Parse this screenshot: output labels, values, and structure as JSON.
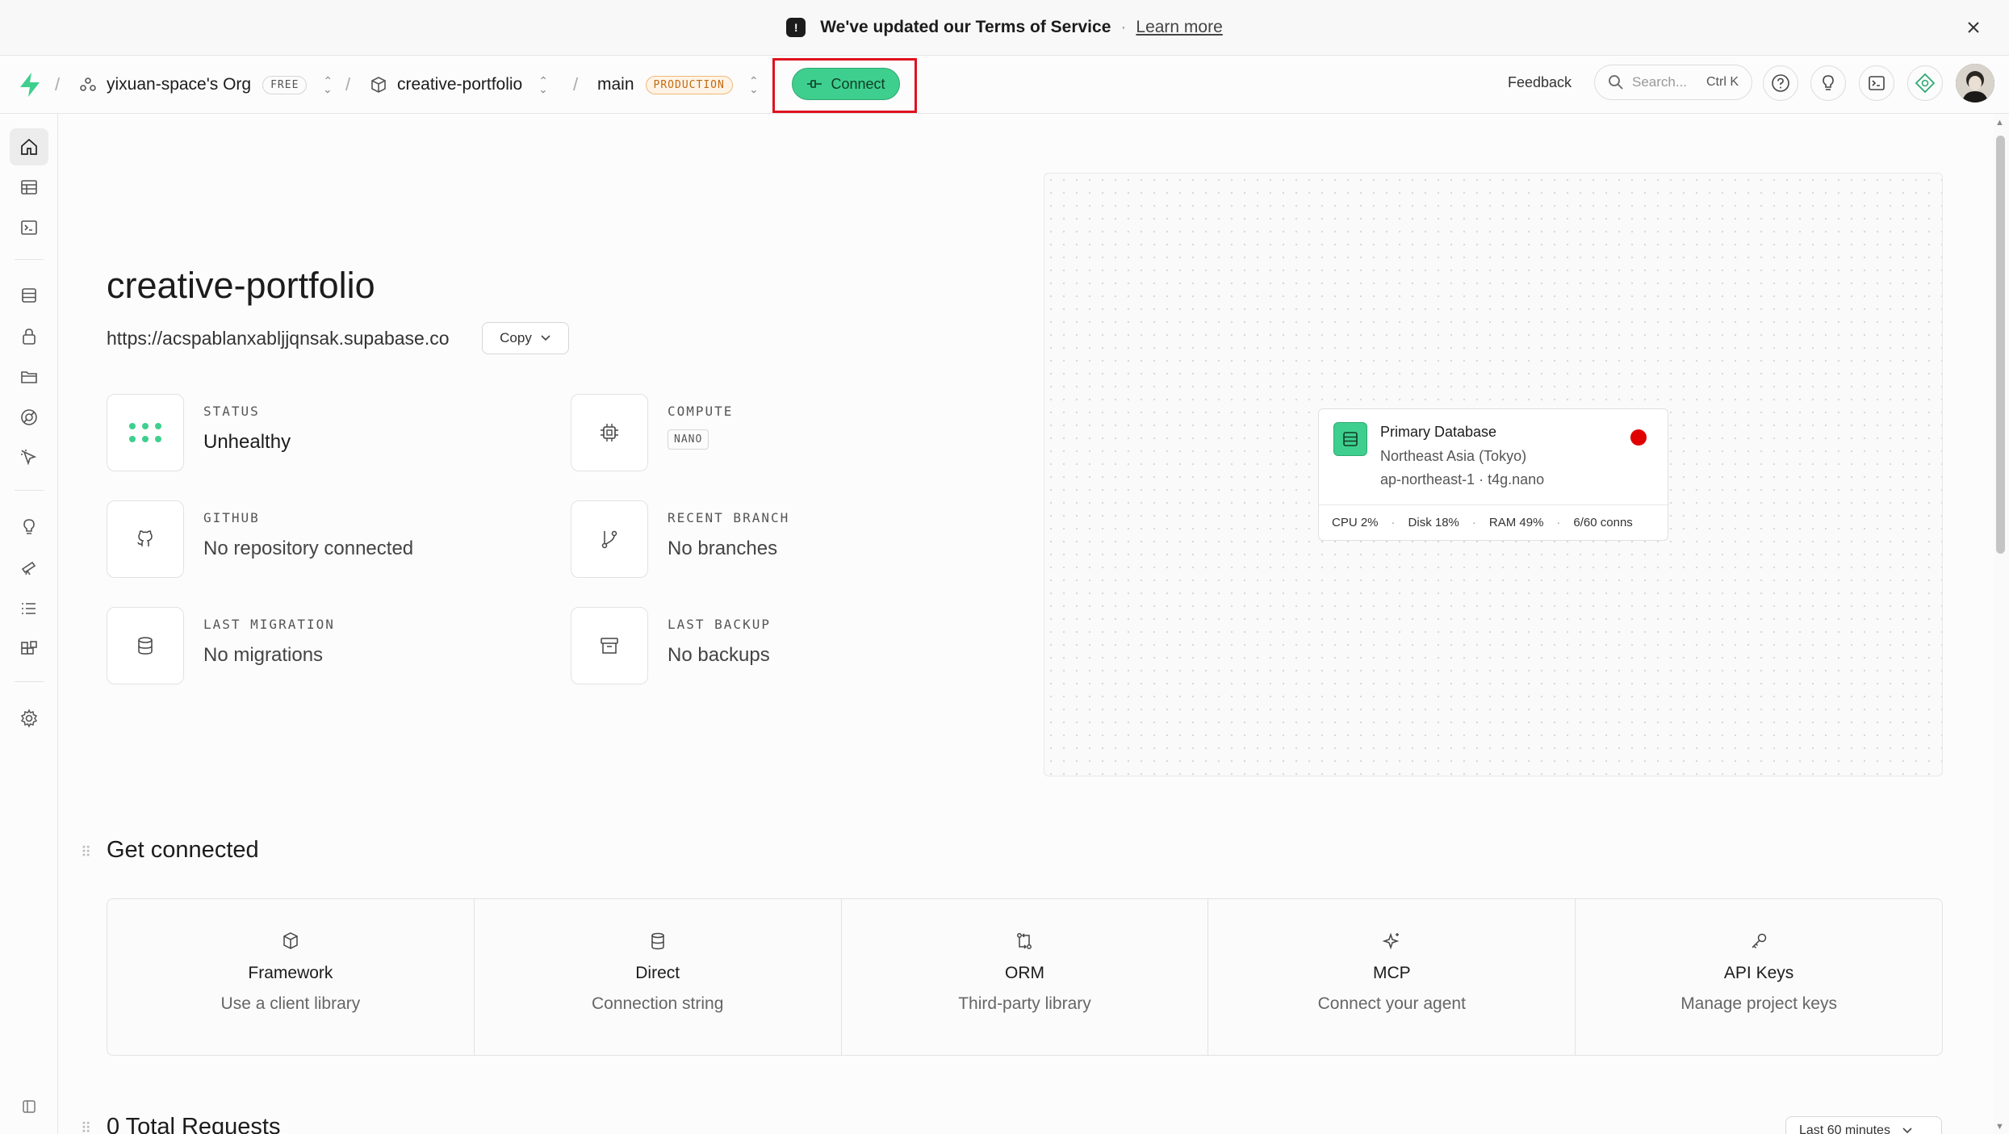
{
  "banner": {
    "text": "We've updated our Terms of Service",
    "separator": "·",
    "link": "Learn more"
  },
  "nav": {
    "org": "yixuan-space's Org",
    "org_plan": "FREE",
    "project": "creative-portfolio",
    "branch": "main",
    "branch_env": "PRODUCTION",
    "connect_label": "Connect",
    "feedback_label": "Feedback",
    "search_placeholder": "Search...",
    "search_shortcut": "Ctrl K"
  },
  "sidebar": {
    "items": [
      "home-icon",
      "table-editor-icon",
      "sql-editor-icon",
      "database-icon",
      "auth-icon",
      "storage-icon",
      "realtime-icon",
      "edge-functions-icon",
      "advisors-icon",
      "reports-icon",
      "logs-icon",
      "integrations-icon",
      "settings-icon"
    ],
    "active": "home-icon"
  },
  "project": {
    "title": "creative-portfolio",
    "url": "https://acspablanxabljjqnsak.supabase.co",
    "copy_label": "Copy"
  },
  "cards": {
    "status": {
      "label": "STATUS",
      "value": "Unhealthy"
    },
    "compute": {
      "label": "COMPUTE",
      "value": "NANO"
    },
    "github": {
      "label": "GITHUB",
      "value": "No repository connected"
    },
    "branch": {
      "label": "RECENT BRANCH",
      "value": "No branches"
    },
    "migration": {
      "label": "LAST MIGRATION",
      "value": "No migrations"
    },
    "backup": {
      "label": "LAST BACKUP",
      "value": "No backups"
    }
  },
  "database": {
    "title": "Primary Database",
    "region": "Northeast Asia (Tokyo)",
    "instance": "ap-northeast-1 · t4g.nano",
    "status_color": "#e00000",
    "stats": [
      "CPU 2%",
      "Disk 18%",
      "RAM 49%",
      "6/60 conns"
    ],
    "stat_separator": "·"
  },
  "get_connected": {
    "heading": "Get connected",
    "items": [
      {
        "title": "Framework",
        "subtitle": "Use a client library",
        "icon": "package-icon"
      },
      {
        "title": "Direct",
        "subtitle": "Connection string",
        "icon": "database-icon"
      },
      {
        "title": "ORM",
        "subtitle": "Third-party library",
        "icon": "orm-icon"
      },
      {
        "title": "MCP",
        "subtitle": "Connect your agent",
        "icon": "sparkle-icon"
      },
      {
        "title": "API Keys",
        "subtitle": "Manage project keys",
        "icon": "key-icon"
      }
    ]
  },
  "requests": {
    "heading": "0 Total Requests",
    "range": "Last 60 minutes"
  },
  "colors": {
    "brand": "#3ecf8e",
    "highlight": "#e0121f",
    "warning": "#c06a12"
  }
}
